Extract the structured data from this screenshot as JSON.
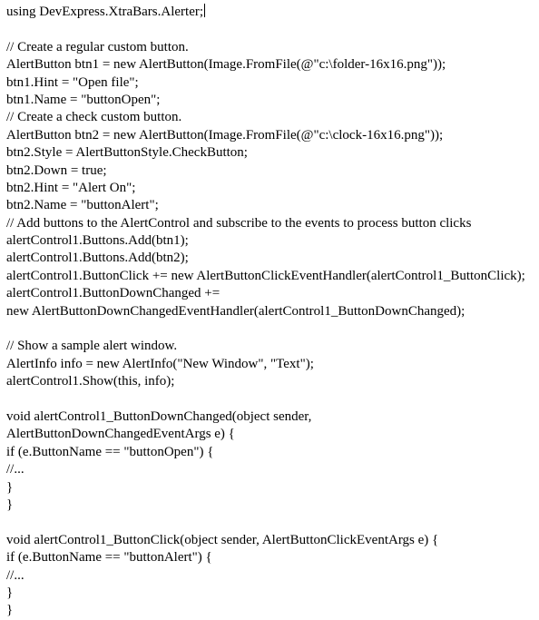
{
  "document": {
    "kind": "code-snippet",
    "language": "csharp",
    "text_color": "#000000",
    "background_color": "#ffffff",
    "caret_visible": true,
    "caret_line_index": 0,
    "lines": [
      {
        "text": "using DevExpress.XtraBars.Alerter;"
      },
      {
        "text": ""
      },
      {
        "text": "// Create a regular custom button."
      },
      {
        "text": "AlertButton btn1 = new AlertButton(Image.FromFile(@\"c:\\folder-16x16.png\"));"
      },
      {
        "text": "btn1.Hint = \"Open file\";"
      },
      {
        "text": "btn1.Name = \"buttonOpen\";"
      },
      {
        "text": "// Create a check custom button."
      },
      {
        "text": "AlertButton btn2 = new AlertButton(Image.FromFile(@\"c:\\clock-16x16.png\"));"
      },
      {
        "text": "btn2.Style = AlertButtonStyle.CheckButton;"
      },
      {
        "text": "btn2.Down = true;"
      },
      {
        "text": "btn2.Hint = \"Alert On\";"
      },
      {
        "text": "btn2.Name = \"buttonAlert\";"
      },
      {
        "text": "// Add buttons to the AlertControl and subscribe to the events to process button clicks"
      },
      {
        "text": "alertControl1.Buttons.Add(btn1);"
      },
      {
        "text": "alertControl1.Buttons.Add(btn2);"
      },
      {
        "text": "alertControl1.ButtonClick += new AlertButtonClickEventHandler(alertControl1_ButtonClick);"
      },
      {
        "text": "alertControl1.ButtonDownChanged +="
      },
      {
        "text": "new AlertButtonDownChangedEventHandler(alertControl1_ButtonDownChanged);"
      },
      {
        "text": ""
      },
      {
        "text": "// Show a sample alert window."
      },
      {
        "text": "AlertInfo info = new AlertInfo(\"New Window\", \"Text\");"
      },
      {
        "text": "alertControl1.Show(this, info);"
      },
      {
        "text": ""
      },
      {
        "text": "void alertControl1_ButtonDownChanged(object sender,"
      },
      {
        "text": "AlertButtonDownChangedEventArgs e) {"
      },
      {
        "text": "if (e.ButtonName == \"buttonOpen\") {"
      },
      {
        "text": "//..."
      },
      {
        "text": "}"
      },
      {
        "text": "}"
      },
      {
        "text": ""
      },
      {
        "text": "void alertControl1_ButtonClick(object sender, AlertButtonClickEventArgs e) {"
      },
      {
        "text": "if (e.ButtonName == \"buttonAlert\") {"
      },
      {
        "text": "//..."
      },
      {
        "text": "}"
      },
      {
        "text": "}"
      }
    ]
  }
}
